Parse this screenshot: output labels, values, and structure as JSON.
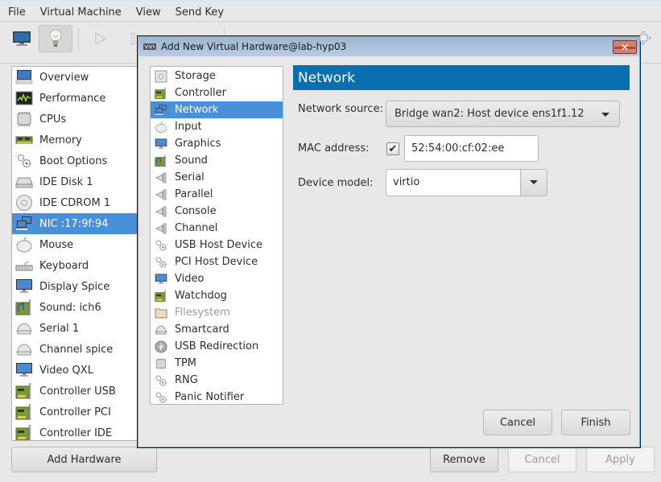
{
  "menubar": {
    "items": [
      "File",
      "Virtual Machine",
      "View",
      "Send Key"
    ]
  },
  "toolbar": {
    "buttons": [
      {
        "name": "console",
        "icon": "monitor-icon"
      },
      {
        "name": "details",
        "icon": "lightbulb-icon",
        "active": true
      },
      {
        "name": "run",
        "icon": "play-icon"
      },
      {
        "name": "pause",
        "icon": "pause-icon"
      },
      {
        "name": "shutdown",
        "icon": "power-icon"
      },
      {
        "name": "snapshots",
        "icon": "snapshot-icon"
      }
    ]
  },
  "hardware_list": {
    "items": [
      {
        "label": "Overview",
        "icon": "overview-monitor-icon"
      },
      {
        "label": "Performance",
        "icon": "performance-graph-icon"
      },
      {
        "label": "CPUs",
        "icon": "cpu-chip-icon"
      },
      {
        "label": "Memory",
        "icon": "memory-module-icon"
      },
      {
        "label": "Boot Options",
        "icon": "gears-icon"
      },
      {
        "label": "IDE Disk 1",
        "icon": "hard-disk-icon"
      },
      {
        "label": "IDE CDROM 1",
        "icon": "cdrom-icon"
      },
      {
        "label": "NIC :17:9f:94",
        "icon": "network-icon",
        "selected": true
      },
      {
        "label": "Mouse",
        "icon": "mouse-icon"
      },
      {
        "label": "Keyboard",
        "icon": "keyboard-icon"
      },
      {
        "label": "Display Spice",
        "icon": "display-monitor-icon"
      },
      {
        "label": "Sound: ich6",
        "icon": "sound-card-icon"
      },
      {
        "label": "Serial 1",
        "icon": "serial-port-icon"
      },
      {
        "label": "Channel spice",
        "icon": "serial-port-icon"
      },
      {
        "label": "Video QXL",
        "icon": "display-monitor-icon"
      },
      {
        "label": "Controller USB",
        "icon": "controller-card-icon"
      },
      {
        "label": "Controller PCI",
        "icon": "controller-card-icon"
      },
      {
        "label": "Controller IDE",
        "icon": "controller-card-icon"
      }
    ],
    "add_button": "Add Hardware"
  },
  "bottom_buttons": {
    "remove": "Remove",
    "cancel": "Cancel",
    "apply": "Apply"
  },
  "dialog": {
    "title": "Add New Virtual Hardware@lab-hyp03",
    "device_types": [
      {
        "label": "Storage",
        "icon": "storage-icon"
      },
      {
        "label": "Controller",
        "icon": "controller-card-icon"
      },
      {
        "label": "Network",
        "icon": "network-icon",
        "selected": true
      },
      {
        "label": "Input",
        "icon": "mouse-icon"
      },
      {
        "label": "Graphics",
        "icon": "display-monitor-icon"
      },
      {
        "label": "Sound",
        "icon": "sound-card-icon"
      },
      {
        "label": "Serial",
        "icon": "port-icon"
      },
      {
        "label": "Parallel",
        "icon": "port-icon"
      },
      {
        "label": "Console",
        "icon": "port-icon"
      },
      {
        "label": "Channel",
        "icon": "port-icon"
      },
      {
        "label": "USB Host Device",
        "icon": "gears-icon"
      },
      {
        "label": "PCI Host Device",
        "icon": "gears-icon"
      },
      {
        "label": "Video",
        "icon": "display-monitor-icon"
      },
      {
        "label": "Watchdog",
        "icon": "controller-card-icon"
      },
      {
        "label": "Filesystem",
        "icon": "folder-icon",
        "disabled": true
      },
      {
        "label": "Smartcard",
        "icon": "smartcard-reader-icon"
      },
      {
        "label": "USB Redirection",
        "icon": "usb-icon"
      },
      {
        "label": "TPM",
        "icon": "cpu-chip-icon"
      },
      {
        "label": "RNG",
        "icon": "gears-icon"
      },
      {
        "label": "Panic Notifier",
        "icon": "gears-icon"
      }
    ],
    "panel_title": "Network",
    "network_source_label": "Network source:",
    "network_source_value": "Bridge wan2: Host device ens1f1.12",
    "mac_label": "MAC address:",
    "mac_checked": true,
    "mac_value": "52:54:00:cf:02:ee",
    "device_model_label": "Device model:",
    "device_model_value": "virtio",
    "cancel": "Cancel",
    "finish": "Finish"
  },
  "colors": {
    "selection": "#4a90d9",
    "header_blue": "#0b6fad",
    "title_bar": "#b8cde4",
    "close_button": "#d5806c"
  }
}
